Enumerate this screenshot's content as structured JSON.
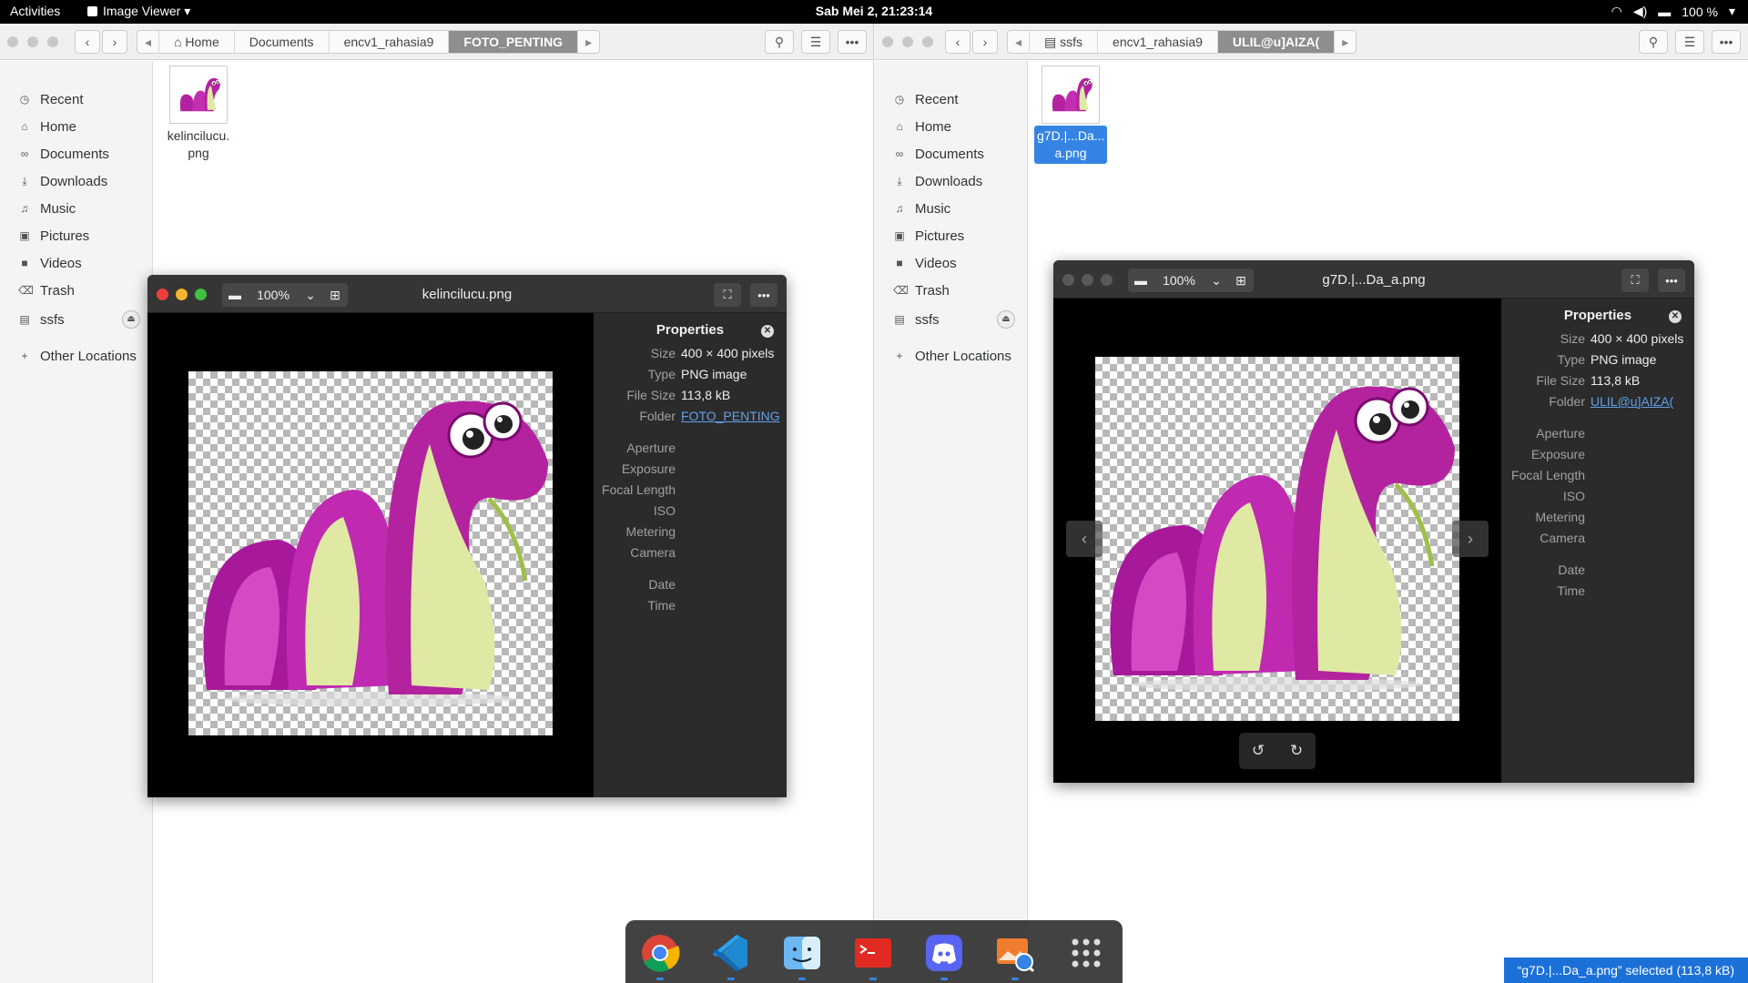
{
  "topbar": {
    "activities": "Activities",
    "app_name": "Image Viewer",
    "clock": "Sab Mei  2, 21:23:14",
    "battery": "100 %"
  },
  "left_files": {
    "breadcrumbs": [
      "Home",
      "Documents",
      "encv1_rahasia9",
      "FOTO_PENTING"
    ],
    "sidebar": [
      "Recent",
      "Home",
      "Documents",
      "Downloads",
      "Music",
      "Pictures",
      "Videos",
      "Trash",
      "ssfs",
      "Other Locations"
    ],
    "file": {
      "name": "kelincilucu.\npng",
      "selected": false
    }
  },
  "right_files": {
    "breadcrumbs": [
      "ssfs",
      "encv1_rahasia9",
      "ULIL@u]AIZA("
    ],
    "sidebar": [
      "Recent",
      "Home",
      "Documents",
      "Downloads",
      "Music",
      "Pictures",
      "Videos",
      "Trash",
      "ssfs",
      "Other Locations"
    ],
    "file": {
      "name": "g7D.|...Da...\na.png",
      "selected": true
    }
  },
  "viewer_left": {
    "title": "kelincilucu.png",
    "zoom": "100%",
    "properties": {
      "heading": "Properties",
      "size_label": "Size",
      "size": "400 × 400 pixels",
      "type_label": "Type",
      "type": "PNG image",
      "filesize_label": "File Size",
      "filesize": "113,8 kB",
      "folder_label": "Folder",
      "folder": "FOTO_PENTING",
      "aperture": "Aperture",
      "exposure": "Exposure",
      "focal": "Focal Length",
      "iso": "ISO",
      "metering": "Metering",
      "camera": "Camera",
      "date": "Date",
      "time": "Time"
    }
  },
  "viewer_right": {
    "title": "g7D.|...Da_a.png",
    "zoom": "100%",
    "properties": {
      "heading": "Properties",
      "size_label": "Size",
      "size": "400 × 400 pixels",
      "type_label": "Type",
      "type": "PNG image",
      "filesize_label": "File Size",
      "filesize": "113,8 kB",
      "folder_label": "Folder",
      "folder": "ULIL@u]AIZA(",
      "aperture": "Aperture",
      "exposure": "Exposure",
      "focal": "Focal Length",
      "iso": "ISO",
      "metering": "Metering",
      "camera": "Camera",
      "date": "Date",
      "time": "Time"
    }
  },
  "dock_apps": [
    "chrome-icon",
    "vscode-icon",
    "finder-icon",
    "terminal-icon",
    "discord-icon",
    "image-viewer-icon",
    "app-grid-icon"
  ],
  "status_toast": "“g7D.|...Da_a.png” selected (113,8 kB)",
  "colors": {
    "accent": "#3584e4",
    "active_crumb": "#8e8e8e",
    "viewer_bg": "#000000",
    "props_bg": "#2b2b2b"
  }
}
